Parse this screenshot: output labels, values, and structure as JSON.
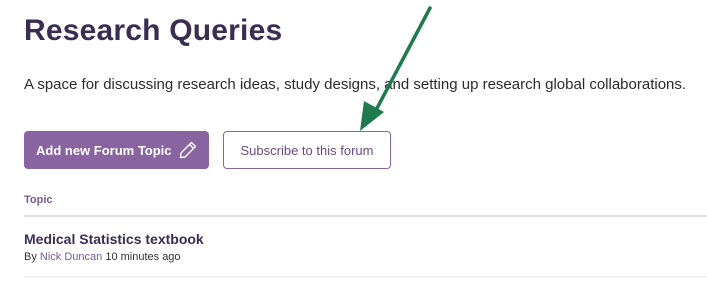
{
  "header": {
    "title": "Research Queries",
    "description": "A space for discussing research ideas, study designs, and setting up research global collaborations."
  },
  "actions": {
    "add_topic_label": "Add new Forum Topic",
    "subscribe_label": "Subscribe to this forum"
  },
  "table": {
    "column_header": "Topic",
    "rows": [
      {
        "title": "Medical Statistics textbook",
        "by_prefix": "By",
        "author": "Nick Duncan",
        "time_ago": "10 minutes ago"
      }
    ]
  },
  "colors": {
    "primary": "#8a64a0",
    "heading": "#3b2d52",
    "annotation_arrow": "#1f7a4d"
  },
  "icons": {
    "add_topic": "pencil-icon",
    "annotation": "arrow-icon"
  }
}
